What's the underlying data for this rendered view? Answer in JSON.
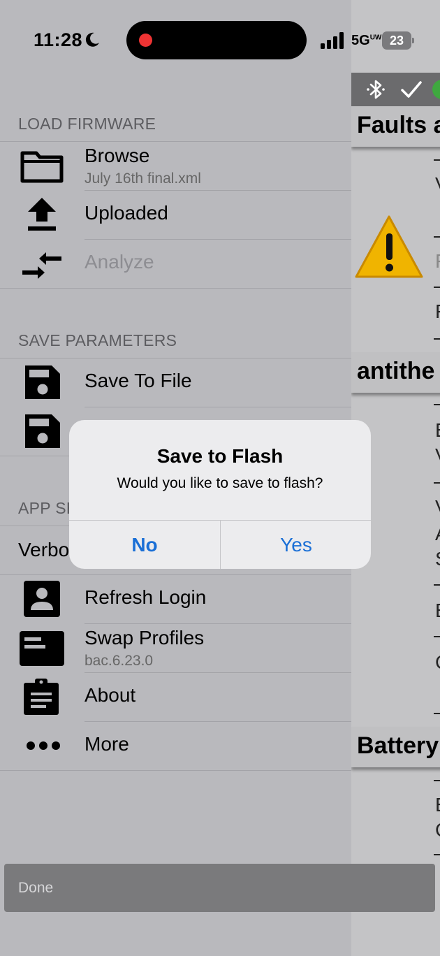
{
  "status_bar": {
    "time": "11:28",
    "network": "5G",
    "network_sup": "UW",
    "battery": "23"
  },
  "menu": {
    "load_firmware": {
      "header": "LOAD FIRMWARE",
      "browse": {
        "label": "Browse",
        "sub": "July 16th final.xml"
      },
      "uploaded": {
        "label": "Uploaded"
      },
      "analyze": {
        "label": "Analyze"
      }
    },
    "save_parameters": {
      "header": "SAVE PARAMETERS",
      "save_to_file": {
        "label": "Save To File"
      }
    },
    "app_settings": {
      "header_visible": "APP SE",
      "verbose_visible": "Verbo",
      "refresh_login": {
        "label": "Refresh Login"
      },
      "swap_profiles": {
        "label": "Swap Profiles",
        "sub": "bac.6.23.0"
      },
      "about": {
        "label": "About"
      },
      "more": {
        "label": "More"
      }
    }
  },
  "alert": {
    "title": "Save to Flash",
    "message": "Would you like to save to flash?",
    "no_label": "No",
    "yes_label": "Yes"
  },
  "right_panel": {
    "sections": [
      "Faults a",
      "antithe",
      "Battery"
    ],
    "row_chars": [
      "V",
      "F",
      "F",
      "E",
      "V",
      "V",
      "A",
      "S",
      "E",
      "C",
      "E",
      "C"
    ]
  },
  "done_label": "Done",
  "colors": {
    "accent": "#1a6fd6",
    "warning": "#f0b400",
    "status_green": "#3fa83f"
  }
}
